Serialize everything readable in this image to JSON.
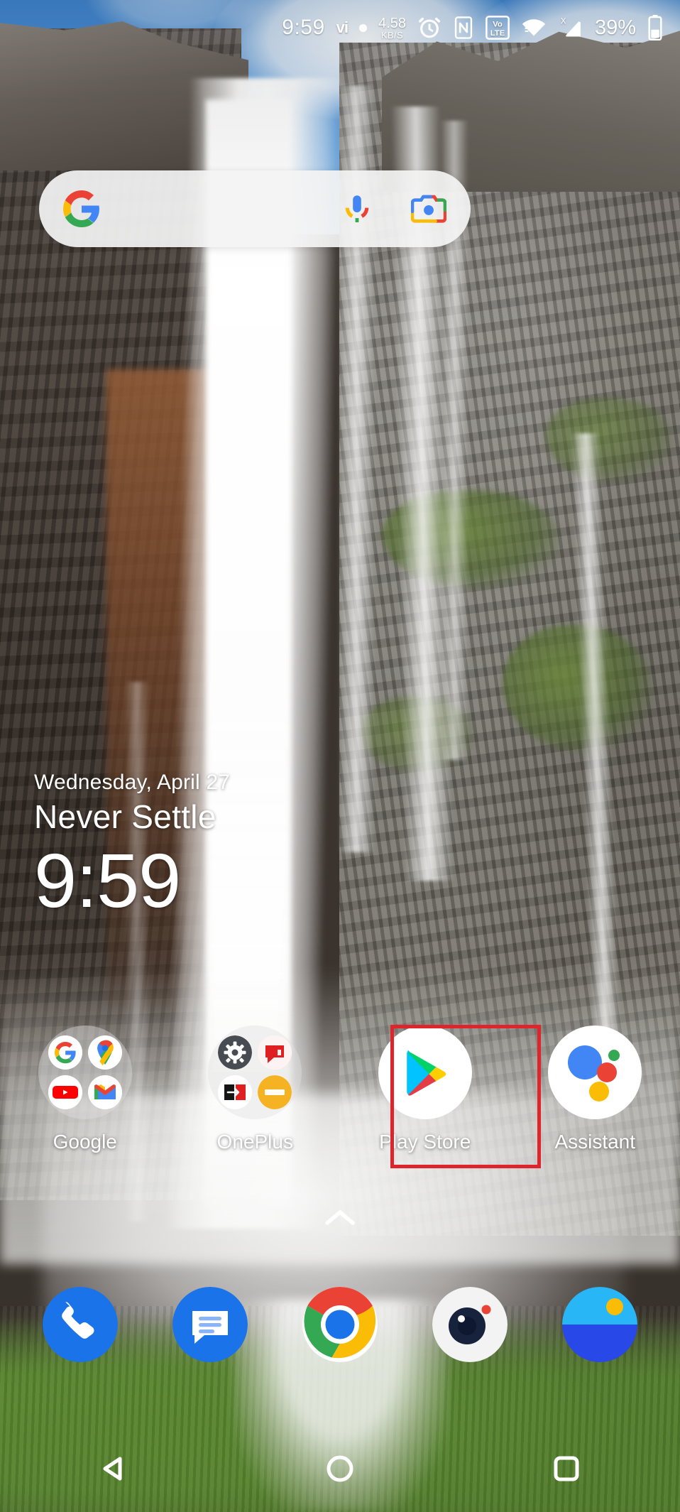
{
  "device": {
    "platform": "Android",
    "launcher": "OnePlus Launcher"
  },
  "status_bar": {
    "time": "9:59",
    "carrier_glyph": "vi",
    "icons": [
      {
        "name": "vi-carrier-icon",
        "label": "vi"
      },
      {
        "name": "dot-indicator-icon",
        "label": ""
      },
      {
        "name": "network-speed-indicator",
        "value": "4.58",
        "unit": "KB/S"
      },
      {
        "name": "alarm-clock-icon",
        "label": "alarm"
      },
      {
        "name": "nfc-icon",
        "label": "N"
      },
      {
        "name": "volte-icon",
        "label_top": "Vo",
        "label_bottom": "LTE"
      },
      {
        "name": "wifi-icon",
        "label": "wifi"
      },
      {
        "name": "cellular-signal-icon",
        "label": "X"
      },
      {
        "name": "battery-icon",
        "label": "battery"
      }
    ],
    "network_speed": "4.58",
    "network_speed_unit": "KB/S",
    "volte_top": "Vo",
    "volte_bottom": "LTE",
    "nfc_letter": "N",
    "signal_x": "X",
    "battery_percent": "39%"
  },
  "search": {
    "placeholder": "",
    "value": "",
    "logo_name": "google-g-logo",
    "mic_name": "microphone-icon",
    "lens_name": "google-lens-camera-icon"
  },
  "clock_widget": {
    "date": "Wednesday, April 27",
    "tagline": "Never Settle",
    "time": "9:59"
  },
  "app_grid": [
    {
      "label": "Google",
      "type": "folder",
      "icon_name": "folder-google",
      "contents": [
        "Google",
        "Maps",
        "YouTube",
        "Gmail"
      ]
    },
    {
      "label": "OnePlus",
      "type": "folder",
      "icon_name": "folder-oneplus",
      "contents": [
        "Settings",
        "Community",
        "Switch",
        "Notes"
      ]
    },
    {
      "label": "Play Store",
      "type": "app",
      "icon_name": "play-store-icon",
      "highlighted": true
    },
    {
      "label": "Assistant",
      "type": "app",
      "icon_name": "google-assistant-icon",
      "highlighted": false
    }
  ],
  "highlight": {
    "target": "Play Store",
    "color": "#e0242c"
  },
  "drawer": {
    "chevron_name": "chevron-up-icon",
    "hint": ""
  },
  "dock": [
    {
      "label": "Phone",
      "icon_name": "phone-icon"
    },
    {
      "label": "Messages",
      "icon_name": "messages-icon"
    },
    {
      "label": "Chrome",
      "icon_name": "chrome-icon"
    },
    {
      "label": "Camera",
      "icon_name": "camera-icon"
    },
    {
      "label": "Weather",
      "icon_name": "weather-icon"
    }
  ],
  "nav_bar": [
    {
      "label": "Back",
      "icon_name": "back-triangle-icon"
    },
    {
      "label": "Home",
      "icon_name": "home-circle-icon"
    },
    {
      "label": "Recents",
      "icon_name": "recents-square-icon"
    }
  ],
  "colors": {
    "highlight_red": "#e0242c",
    "google_blue": "#4285F4",
    "google_red": "#EA4335",
    "google_yellow": "#FBBC05",
    "google_green": "#34A853",
    "search_bg": "#f3f3f3",
    "status_text": "#ffffff"
  }
}
